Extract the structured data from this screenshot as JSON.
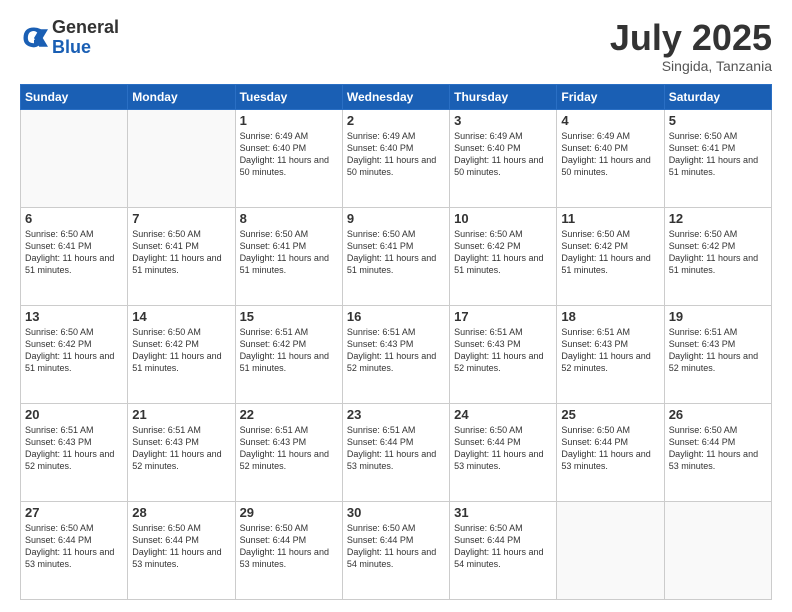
{
  "logo": {
    "general": "General",
    "blue": "Blue"
  },
  "header": {
    "month": "July 2025",
    "location": "Singida, Tanzania"
  },
  "weekdays": [
    "Sunday",
    "Monday",
    "Tuesday",
    "Wednesday",
    "Thursday",
    "Friday",
    "Saturday"
  ],
  "weeks": [
    [
      {
        "day": "",
        "info": ""
      },
      {
        "day": "",
        "info": ""
      },
      {
        "day": "1",
        "info": "Sunrise: 6:49 AM\nSunset: 6:40 PM\nDaylight: 11 hours and 50 minutes."
      },
      {
        "day": "2",
        "info": "Sunrise: 6:49 AM\nSunset: 6:40 PM\nDaylight: 11 hours and 50 minutes."
      },
      {
        "day": "3",
        "info": "Sunrise: 6:49 AM\nSunset: 6:40 PM\nDaylight: 11 hours and 50 minutes."
      },
      {
        "day": "4",
        "info": "Sunrise: 6:49 AM\nSunset: 6:40 PM\nDaylight: 11 hours and 50 minutes."
      },
      {
        "day": "5",
        "info": "Sunrise: 6:50 AM\nSunset: 6:41 PM\nDaylight: 11 hours and 51 minutes."
      }
    ],
    [
      {
        "day": "6",
        "info": "Sunrise: 6:50 AM\nSunset: 6:41 PM\nDaylight: 11 hours and 51 minutes."
      },
      {
        "day": "7",
        "info": "Sunrise: 6:50 AM\nSunset: 6:41 PM\nDaylight: 11 hours and 51 minutes."
      },
      {
        "day": "8",
        "info": "Sunrise: 6:50 AM\nSunset: 6:41 PM\nDaylight: 11 hours and 51 minutes."
      },
      {
        "day": "9",
        "info": "Sunrise: 6:50 AM\nSunset: 6:41 PM\nDaylight: 11 hours and 51 minutes."
      },
      {
        "day": "10",
        "info": "Sunrise: 6:50 AM\nSunset: 6:42 PM\nDaylight: 11 hours and 51 minutes."
      },
      {
        "day": "11",
        "info": "Sunrise: 6:50 AM\nSunset: 6:42 PM\nDaylight: 11 hours and 51 minutes."
      },
      {
        "day": "12",
        "info": "Sunrise: 6:50 AM\nSunset: 6:42 PM\nDaylight: 11 hours and 51 minutes."
      }
    ],
    [
      {
        "day": "13",
        "info": "Sunrise: 6:50 AM\nSunset: 6:42 PM\nDaylight: 11 hours and 51 minutes."
      },
      {
        "day": "14",
        "info": "Sunrise: 6:50 AM\nSunset: 6:42 PM\nDaylight: 11 hours and 51 minutes."
      },
      {
        "day": "15",
        "info": "Sunrise: 6:51 AM\nSunset: 6:42 PM\nDaylight: 11 hours and 51 minutes."
      },
      {
        "day": "16",
        "info": "Sunrise: 6:51 AM\nSunset: 6:43 PM\nDaylight: 11 hours and 52 minutes."
      },
      {
        "day": "17",
        "info": "Sunrise: 6:51 AM\nSunset: 6:43 PM\nDaylight: 11 hours and 52 minutes."
      },
      {
        "day": "18",
        "info": "Sunrise: 6:51 AM\nSunset: 6:43 PM\nDaylight: 11 hours and 52 minutes."
      },
      {
        "day": "19",
        "info": "Sunrise: 6:51 AM\nSunset: 6:43 PM\nDaylight: 11 hours and 52 minutes."
      }
    ],
    [
      {
        "day": "20",
        "info": "Sunrise: 6:51 AM\nSunset: 6:43 PM\nDaylight: 11 hours and 52 minutes."
      },
      {
        "day": "21",
        "info": "Sunrise: 6:51 AM\nSunset: 6:43 PM\nDaylight: 11 hours and 52 minutes."
      },
      {
        "day": "22",
        "info": "Sunrise: 6:51 AM\nSunset: 6:43 PM\nDaylight: 11 hours and 52 minutes."
      },
      {
        "day": "23",
        "info": "Sunrise: 6:51 AM\nSunset: 6:44 PM\nDaylight: 11 hours and 53 minutes."
      },
      {
        "day": "24",
        "info": "Sunrise: 6:50 AM\nSunset: 6:44 PM\nDaylight: 11 hours and 53 minutes."
      },
      {
        "day": "25",
        "info": "Sunrise: 6:50 AM\nSunset: 6:44 PM\nDaylight: 11 hours and 53 minutes."
      },
      {
        "day": "26",
        "info": "Sunrise: 6:50 AM\nSunset: 6:44 PM\nDaylight: 11 hours and 53 minutes."
      }
    ],
    [
      {
        "day": "27",
        "info": "Sunrise: 6:50 AM\nSunset: 6:44 PM\nDaylight: 11 hours and 53 minutes."
      },
      {
        "day": "28",
        "info": "Sunrise: 6:50 AM\nSunset: 6:44 PM\nDaylight: 11 hours and 53 minutes."
      },
      {
        "day": "29",
        "info": "Sunrise: 6:50 AM\nSunset: 6:44 PM\nDaylight: 11 hours and 53 minutes."
      },
      {
        "day": "30",
        "info": "Sunrise: 6:50 AM\nSunset: 6:44 PM\nDaylight: 11 hours and 54 minutes."
      },
      {
        "day": "31",
        "info": "Sunrise: 6:50 AM\nSunset: 6:44 PM\nDaylight: 11 hours and 54 minutes."
      },
      {
        "day": "",
        "info": ""
      },
      {
        "day": "",
        "info": ""
      }
    ]
  ]
}
